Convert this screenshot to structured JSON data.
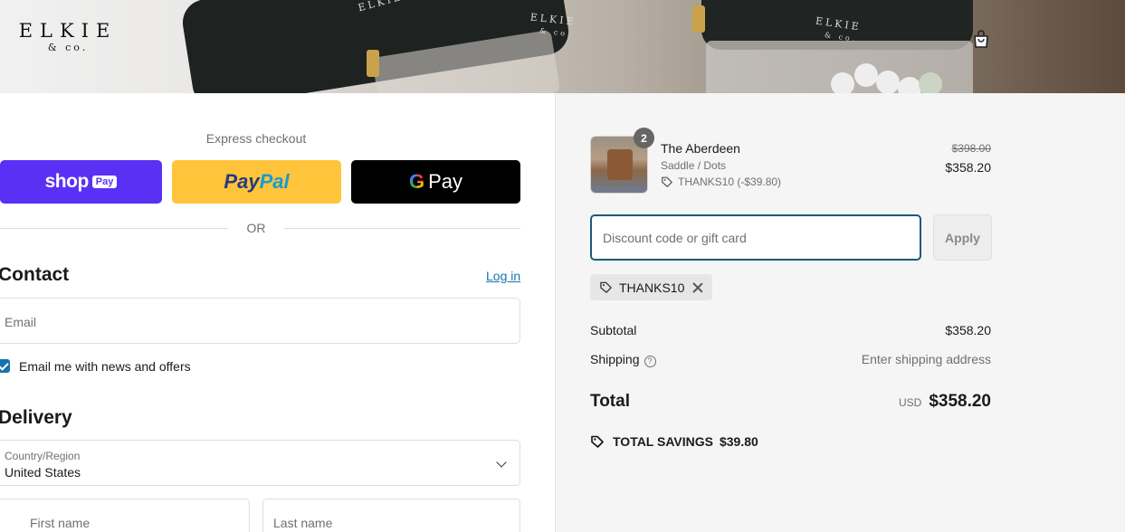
{
  "header": {
    "logo_main": "ELKIE",
    "logo_sub": "& co.",
    "bag_brand": "ELKIE",
    "bag_brand_sub": "& co.",
    "cart_icon": "shopping-bag-icon"
  },
  "checkout": {
    "express_label": "Express checkout",
    "shop_pay": {
      "text": "shop",
      "badge": "Pay"
    },
    "paypal": {
      "part1": "Pay",
      "part2": "Pal"
    },
    "gpay": {
      "g": "G",
      "text": "Pay"
    },
    "or_label": "OR",
    "contact": {
      "title": "Contact",
      "login_link": "Log in",
      "email_placeholder": "Email",
      "news_checkbox_label": "Email me with news and offers",
      "news_checked": true
    },
    "delivery": {
      "title": "Delivery",
      "country_label": "Country/Region",
      "country_value": "United States",
      "first_name_placeholder": "First name",
      "last_name_placeholder": "Last name"
    }
  },
  "summary": {
    "item": {
      "name": "The Aberdeen",
      "variant": "Saddle / Dots",
      "discount": "THANKS10 (-$39.80)",
      "quantity": "2",
      "price_original": "$398.00",
      "price_final": "$358.20"
    },
    "discount_placeholder": "Discount code or gift card",
    "apply_label": "Apply",
    "applied_code": "THANKS10",
    "subtotal_label": "Subtotal",
    "subtotal_value": "$358.20",
    "shipping_label": "Shipping",
    "shipping_help": "?",
    "shipping_value": "Enter shipping address",
    "total_label": "Total",
    "currency": "USD",
    "total_value": "$358.20",
    "savings_label": "TOTAL SAVINGS",
    "savings_value": "$39.80"
  },
  "colors": {
    "shop_pay": "#5a31f4",
    "paypal": "#ffc439",
    "gpay": "#000000",
    "link": "#1773b0",
    "focus_border": "#1a5b78"
  }
}
